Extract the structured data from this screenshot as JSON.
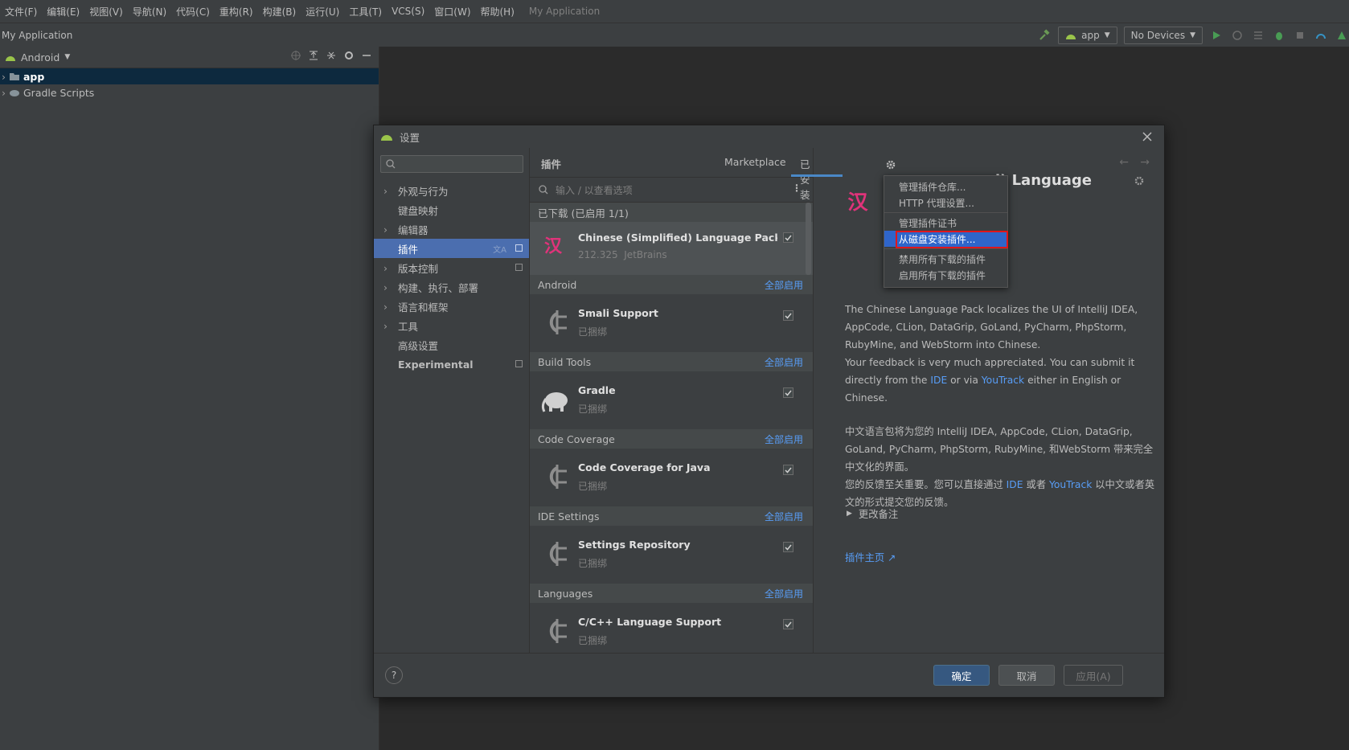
{
  "menu": {
    "items": [
      "文件(F)",
      "编辑(E)",
      "视图(V)",
      "导航(N)",
      "代码(C)",
      "重构(R)",
      "构建(B)",
      "运行(U)",
      "工具(T)",
      "VCS(S)",
      "窗口(W)",
      "帮助(H)"
    ],
    "app_title": "My Application"
  },
  "navbar": {
    "breadcrumb": "My Application",
    "run_config": "app",
    "device": "No Devices"
  },
  "project": {
    "view_mode": "Android",
    "tree": [
      {
        "label": "app",
        "selected": true
      },
      {
        "label": "Gradle Scripts",
        "selected": false
      }
    ]
  },
  "dialog": {
    "title": "设置",
    "search_placeholder": "",
    "nav": [
      {
        "label": "外观与行为",
        "expandable": true,
        "selected": false,
        "tag": false
      },
      {
        "label": "键盘映射",
        "expandable": false,
        "selected": false,
        "tag": false
      },
      {
        "label": "编辑器",
        "expandable": true,
        "selected": false,
        "tag": false
      },
      {
        "label": "插件",
        "expandable": false,
        "selected": true,
        "tag": true
      },
      {
        "label": "版本控制",
        "expandable": true,
        "selected": false,
        "tag": true
      },
      {
        "label": "构建、执行、部署",
        "expandable": true,
        "selected": false,
        "tag": false
      },
      {
        "label": "语言和框架",
        "expandable": true,
        "selected": false,
        "tag": false
      },
      {
        "label": "工具",
        "expandable": true,
        "selected": false,
        "tag": false
      },
      {
        "label": "高级设置",
        "expandable": false,
        "selected": false,
        "tag": false
      },
      {
        "label": "Experimental",
        "expandable": false,
        "selected": false,
        "tag": true
      }
    ],
    "plugins_title": "插件",
    "tabs": {
      "marketplace": "Marketplace",
      "installed": "已安装"
    },
    "plugin_search_placeholder": "输入 / 以查看选项",
    "downloaded_header": "已下载 (已启用 1/1)",
    "enable_all_label": "全部启用",
    "bundled_label": "已捆绑",
    "selected_plugin": {
      "name": "Chinese (Simplified) Language Pack / ...",
      "version": "212.325",
      "vendor": "JetBrains"
    },
    "groups": [
      {
        "name": "Android",
        "plugin": "Smali Support",
        "icon": "plug-icon"
      },
      {
        "name": "Build Tools",
        "plugin": "Gradle",
        "icon": "elephant-icon"
      },
      {
        "name": "Code Coverage",
        "plugin": "Code Coverage for Java",
        "icon": "plug-icon"
      },
      {
        "name": "IDE Settings",
        "plugin": "Settings Repository",
        "icon": "plug-icon"
      },
      {
        "name": "Languages",
        "plugin": "C/C++ Language Support",
        "icon": "plug-icon"
      }
    ],
    "detail": {
      "title_visible": "ed) Language",
      "desc_en_1": "The Chinese Language Pack localizes the UI of IntelliJ IDEA, AppCode, CLion, DataGrip, GoLand, PyCharm, PhpStorm, RubyMine, and WebStorm into Chinese.",
      "desc_en_2_pre": "Your feedback is very much appreciated. You can submit it directly from the ",
      "desc_en_2_ide": "IDE",
      "desc_en_2_mid": " or via ",
      "desc_en_2_yt": "YouTrack",
      "desc_en_2_post": " either in English or Chinese.",
      "desc_zh_1": "中文语言包将为您的 IntelliJ IDEA, AppCode, CLion, DataGrip, GoLand, PyCharm, PhpStorm, RubyMine, 和WebStorm 带来完全中文化的界面。",
      "desc_zh_2_pre": "您的反馈至关重要。您可以直接通过 ",
      "desc_zh_2_ide": "IDE",
      "desc_zh_2_mid": " 或者 ",
      "desc_zh_2_yt": "YouTrack",
      "desc_zh_2_post": " 以中文或者英文的形式提交您的反馈。",
      "change_notes": "更改备注",
      "homepage": "插件主页 ↗"
    },
    "gear_menu": [
      "管理插件仓库...",
      "HTTP 代理设置...",
      "管理插件证书",
      "从磁盘安装插件...",
      "禁用所有下载的插件",
      "启用所有下载的插件"
    ],
    "buttons": {
      "ok": "确定",
      "cancel": "取消",
      "apply": "应用(A)",
      "help": "?"
    }
  },
  "colors": {
    "accent": "#4b6eaf",
    "link": "#589df6",
    "highlight": "#e0161b"
  }
}
